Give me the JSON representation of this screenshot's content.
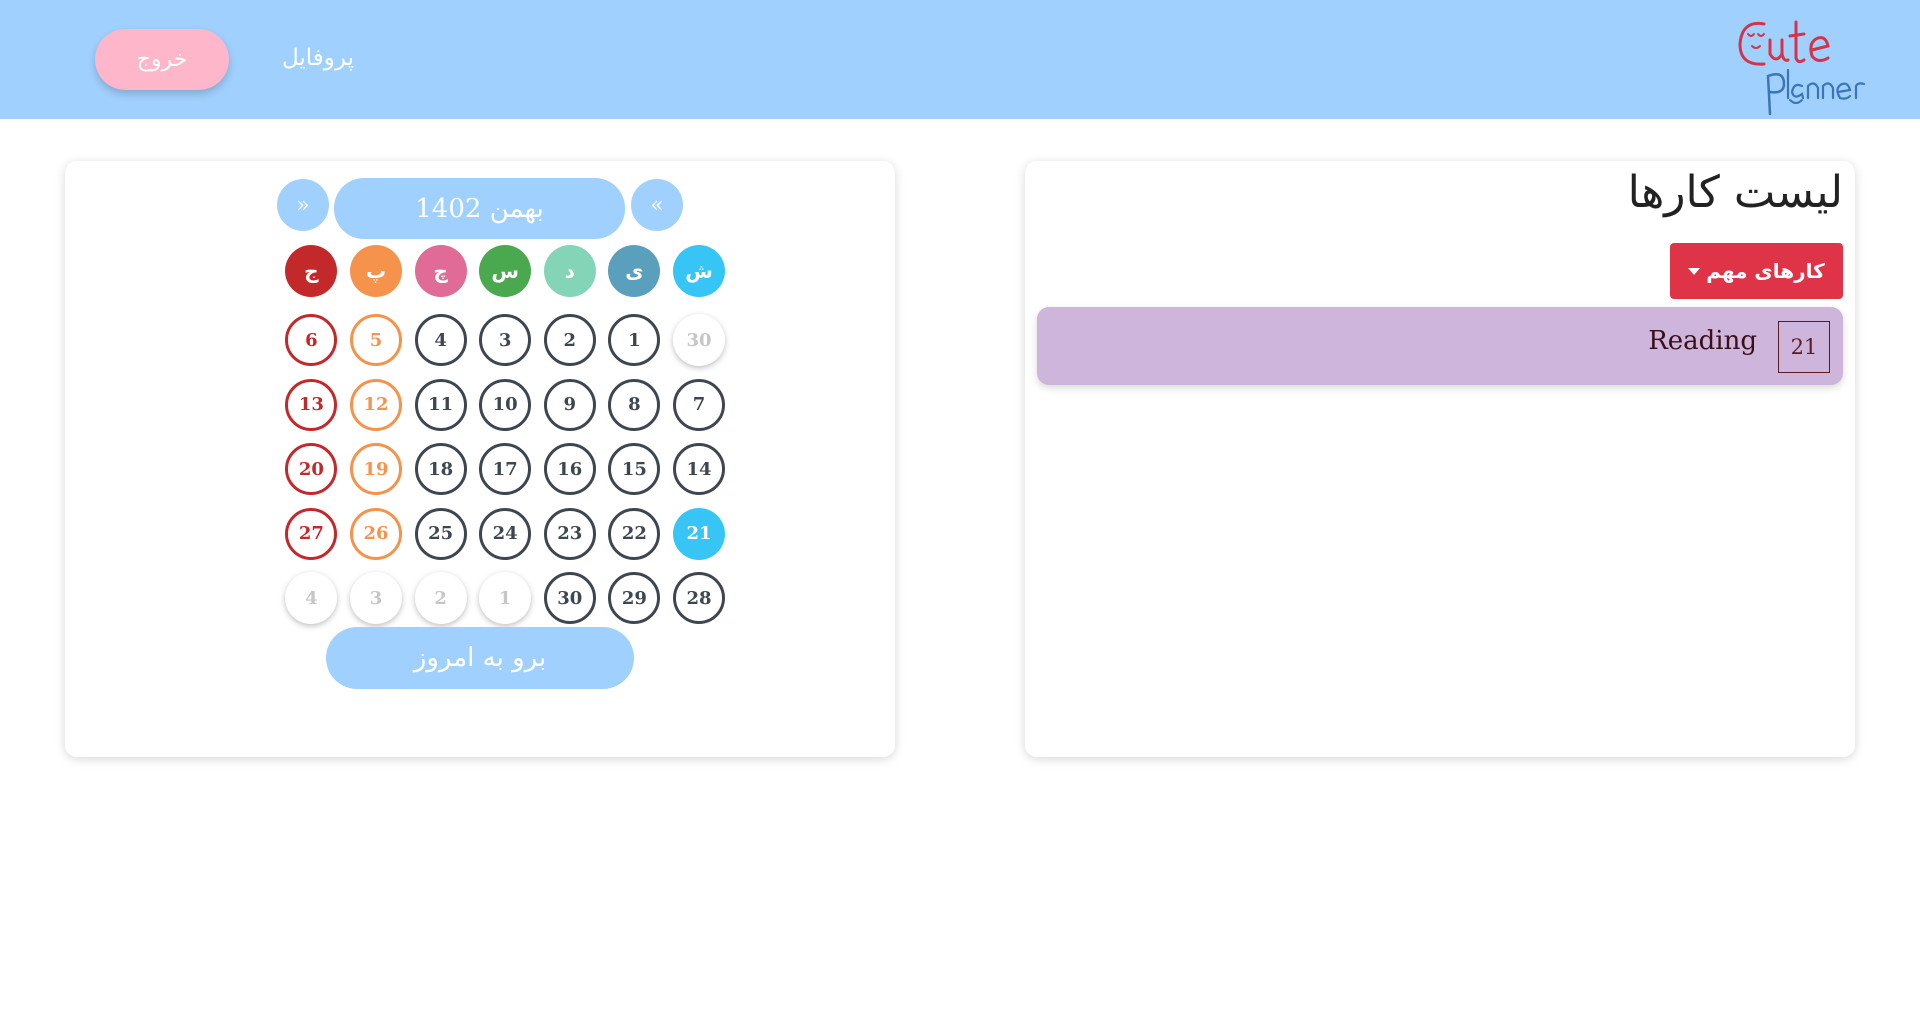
{
  "colors": {
    "navbar": "#a0d0fe",
    "logout_button": "#fdb6ca",
    "today_circle": "#36c5f5",
    "friday": "#c3282b",
    "thursday": "#f5924c",
    "filter_button": "#df3447",
    "task_item": "#cdb5dc"
  },
  "navbar": {
    "logout_label": "خروج",
    "profile_label": "پروفایل",
    "logo": {
      "icon": "cute-planner-logo",
      "text_top": "Cute",
      "text_bottom": "Planner"
    }
  },
  "calendar": {
    "month_title": "بهمن 1402",
    "prev_label": "«",
    "next_label": "»",
    "weekdays": [
      {
        "label": "ش",
        "color": "#36c5f5"
      },
      {
        "label": "ی",
        "color": "#5aa0bd"
      },
      {
        "label": "د",
        "color": "#84d4b8"
      },
      {
        "label": "س",
        "color": "#4aa84e"
      },
      {
        "label": "چ",
        "color": "#e06b96"
      },
      {
        "label": "پ",
        "color": "#f5924c"
      },
      {
        "label": "ج",
        "color": "#c3282b"
      }
    ],
    "weeks": [
      [
        "30",
        "1",
        "2",
        "3",
        "4",
        "5",
        "6"
      ],
      [
        "7",
        "8",
        "9",
        "10",
        "11",
        "12",
        "13"
      ],
      [
        "14",
        "15",
        "16",
        "17",
        "18",
        "19",
        "20"
      ],
      [
        "21",
        "22",
        "23",
        "24",
        "25",
        "26",
        "27"
      ],
      [
        "28",
        "29",
        "30",
        "1",
        "2",
        "3",
        "4"
      ]
    ],
    "today": "21",
    "today_button_label": "برو به امروز"
  },
  "todo": {
    "title": "لیست کارها",
    "filter_label": "کارهای مهم",
    "tasks": [
      {
        "day": "21",
        "title": "Reading"
      }
    ]
  }
}
